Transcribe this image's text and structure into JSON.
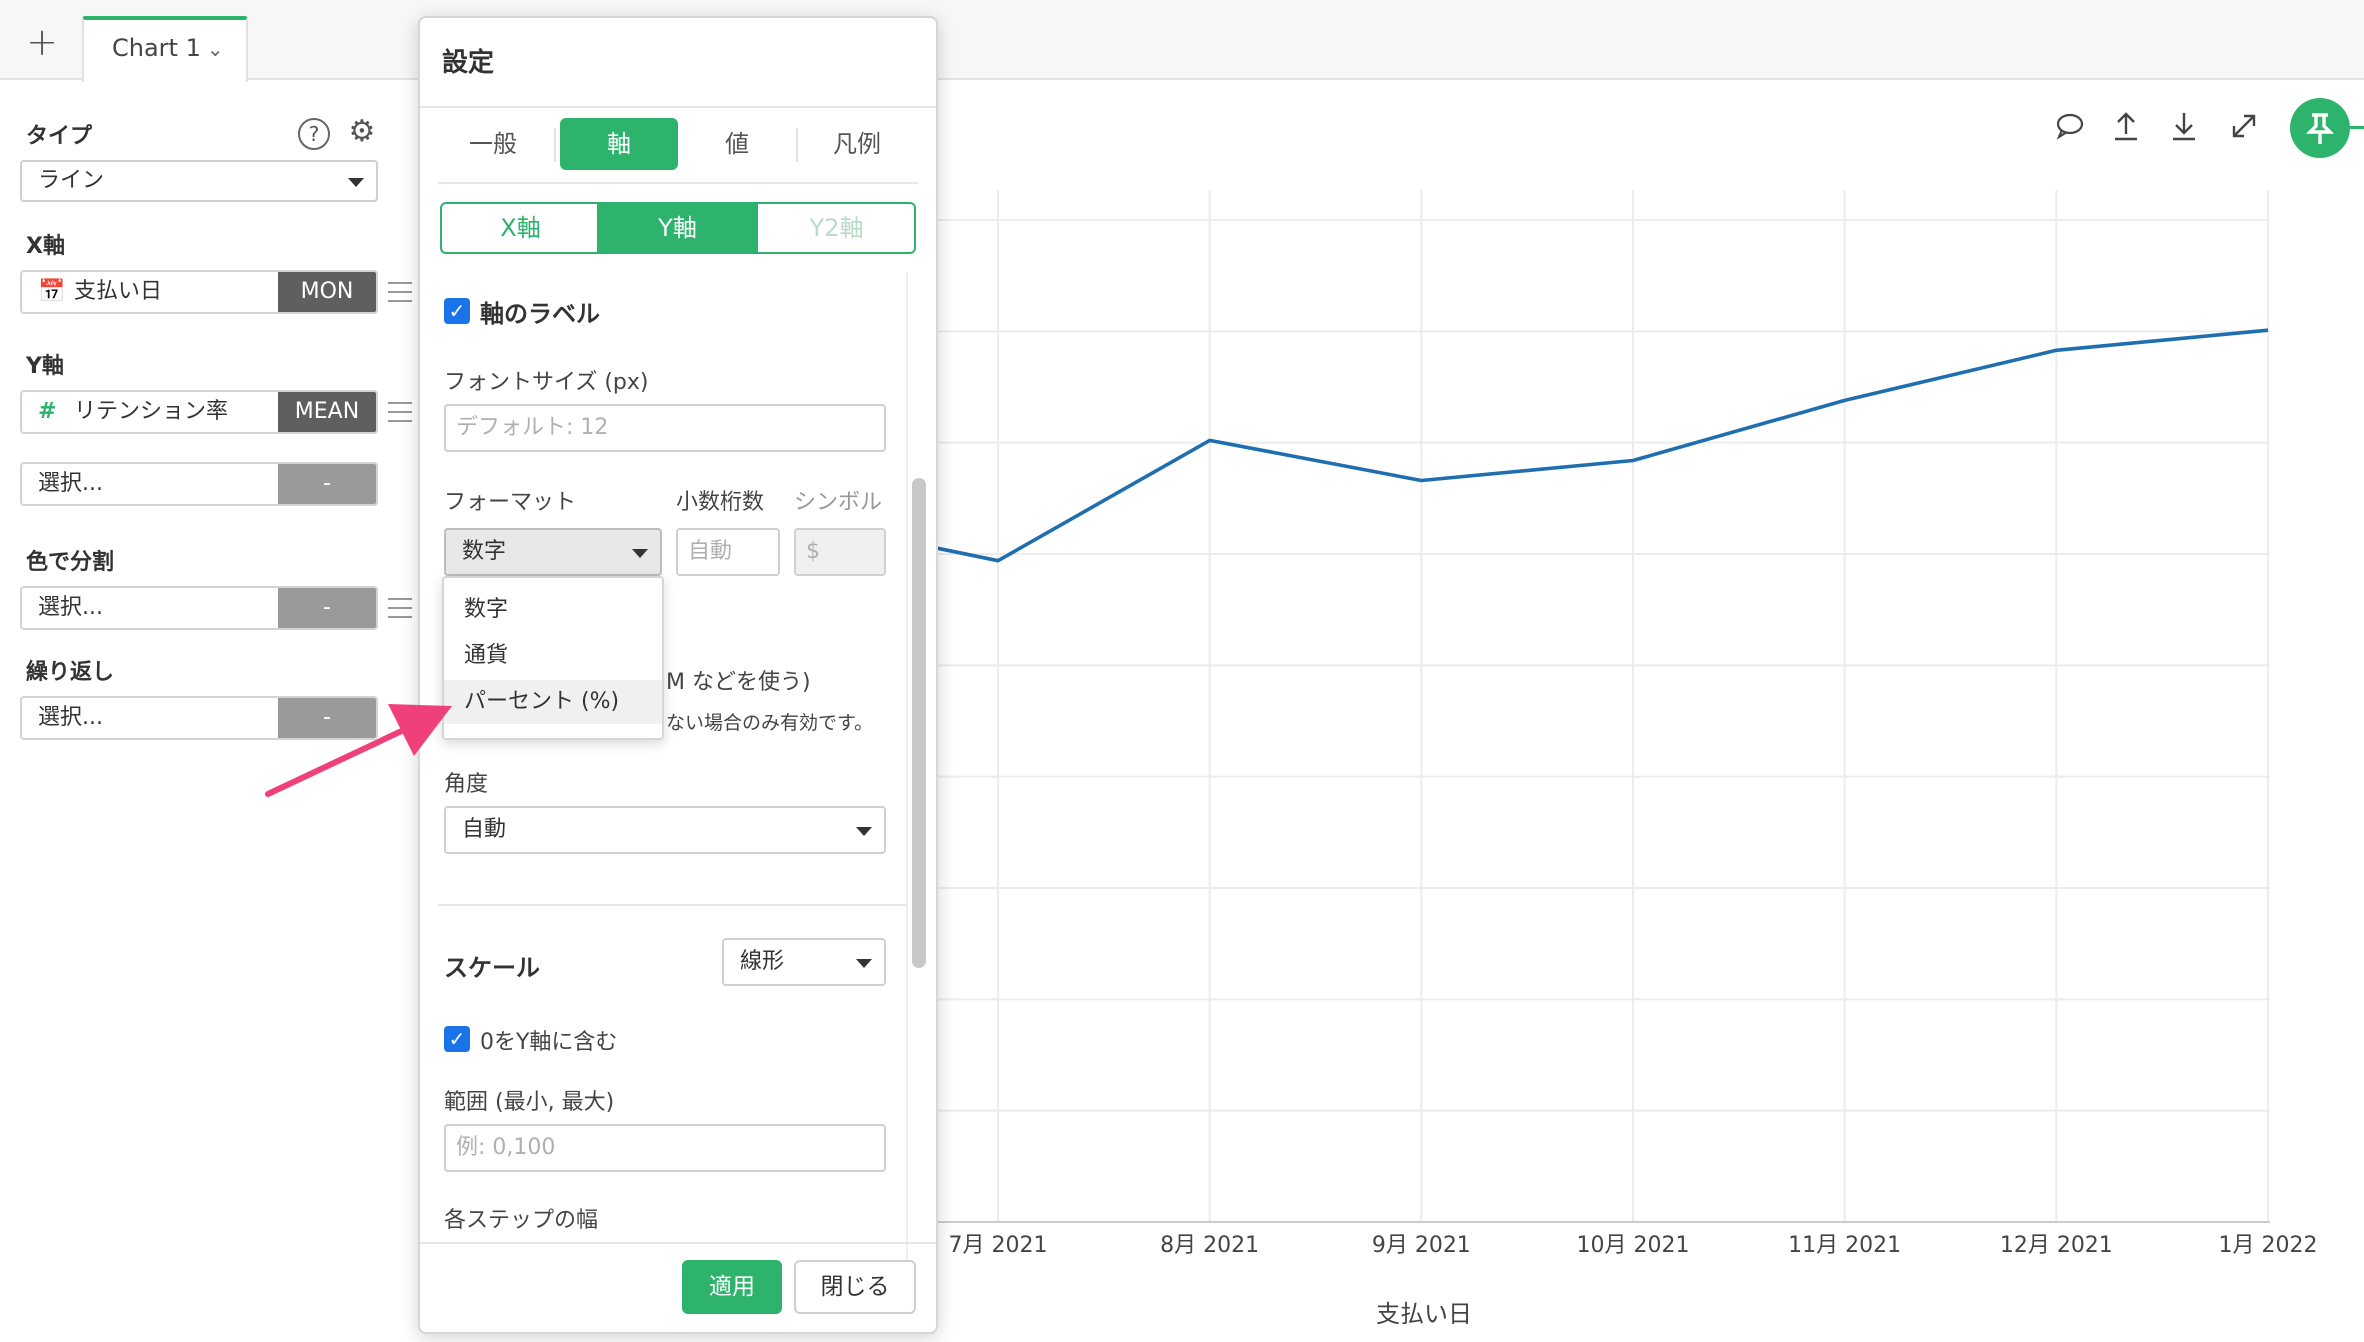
{
  "tabbar": {
    "add_label": "+",
    "chart_tab_label": "Chart 1"
  },
  "sidebar": {
    "type_label": "タイプ",
    "type_value": "ライン",
    "x_axis_label": "X軸",
    "x_field": {
      "name": "支払い日",
      "agg": "MON"
    },
    "y_axis_label": "Y軸",
    "y_field": {
      "name": "リテンション率",
      "agg": "MEAN"
    },
    "y_extra": {
      "placeholder": "選択...",
      "agg": "-"
    },
    "color_label": "色で分割",
    "color_field": {
      "placeholder": "選択...",
      "agg": "-"
    },
    "repeat_label": "繰り返し",
    "repeat_field": {
      "placeholder": "選択...",
      "agg": "-"
    }
  },
  "panel": {
    "title": "設定",
    "tabs": [
      "一般",
      "軸",
      "値",
      "凡例"
    ],
    "active_tab": "軸",
    "axis_tabs": [
      "X軸",
      "Y軸",
      "Y2軸"
    ],
    "active_axis_tab": "Y軸",
    "axis_label_checkbox": "軸のラベル",
    "font_size_label": "フォントサイズ (px)",
    "font_size_placeholder": "デフォルト: 12",
    "format_label": "フォーマット",
    "decimals_label": "小数桁数",
    "symbol_label": "シンボル",
    "format_value": "数字",
    "decimals_placeholder": "自動",
    "symbol_placeholder": "$",
    "format_options": [
      "数字",
      "通貨",
      "パーセント (%)"
    ],
    "hidden_option_text": "M などを使う)",
    "hidden_note_text": "ない場合のみ有効です。",
    "angle_label": "角度",
    "angle_value": "自動",
    "scale_label": "スケール",
    "scale_value": "線形",
    "include_zero_label": "0をY軸に含む",
    "range_label": "範囲 (最小, 最大)",
    "range_placeholder": "例: 0,100",
    "step_label": "各ステップの幅",
    "apply_button": "適用",
    "close_button": "閉じる"
  },
  "colors": {
    "accent": "#2db36b",
    "line": "#1f6fb0",
    "arrow": "#f0407a",
    "checkbox": "#1a73e8"
  },
  "chart_data": {
    "type": "line",
    "x": [
      "7月 2021",
      "8月 2021",
      "9月 2021",
      "10月 2021",
      "11月 2021",
      "12月 2021",
      "1月 2022"
    ],
    "values": [
      0.66,
      0.78,
      0.74,
      0.76,
      0.82,
      0.87,
      0.89
    ],
    "xlabel": "支払い日",
    "ylabel": "",
    "ylim": [
      0,
      1
    ],
    "grid": true,
    "legend": "none"
  }
}
